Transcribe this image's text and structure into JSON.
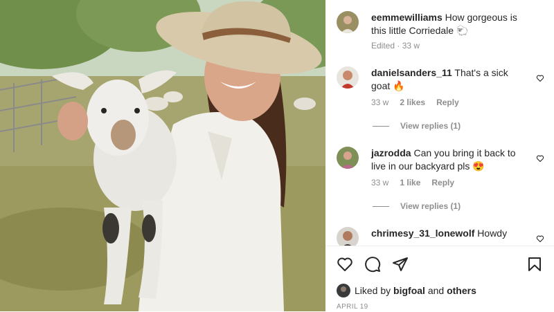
{
  "comments": [
    {
      "username": "eemmewilliams",
      "text": "How gorgeous is this little Corriedale 🐑",
      "meta": "Edited · 33 w",
      "likes": "",
      "reply": "",
      "view_replies": ""
    },
    {
      "username": "danielsanders_11",
      "text": "That's a sick goat 🔥",
      "meta": "33 w",
      "likes": "2 likes",
      "reply": "Reply",
      "view_replies": "View replies (1)"
    },
    {
      "username": "jazrodda",
      "text": "Can you bring it back to live in our backyard pls 😍",
      "meta": "33 w",
      "likes": "1 like",
      "reply": "Reply",
      "view_replies": "View replies (1)"
    },
    {
      "username": "chrimesy_31_lonewolf",
      "text": "Howdy",
      "meta": "",
      "likes": "",
      "reply": "",
      "view_replies": ""
    }
  ],
  "footer": {
    "liked_prefix": "Liked by",
    "liked_user": "bigfoal",
    "liked_and": "and",
    "liked_others": "others",
    "date": "APRIL 19"
  },
  "icons": {
    "like": "heart-icon",
    "comment": "comment-icon",
    "share": "paper-plane-icon",
    "save": "bookmark-icon"
  }
}
